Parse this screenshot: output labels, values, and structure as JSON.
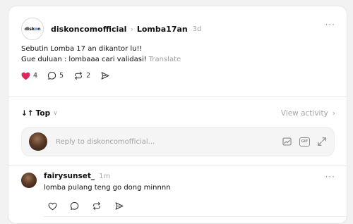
{
  "post": {
    "avatar_logo_text": "diskon",
    "author": "diskoncomofficial",
    "separator": "›",
    "topic": "Lomba17an",
    "time": "3d",
    "more": "···",
    "line1": "Sebutin Lomba 17 an dikantor lu!!",
    "line2": "Gue duluan : lombaaa cari validasi!",
    "translate": "Translate",
    "likes": "4",
    "replies": "5",
    "reposts": "2",
    "accent_like_color": "#e0245e"
  },
  "sort": {
    "arrows": "↓↑",
    "label": "Top",
    "dropdown": "∨",
    "view_activity": "View activity",
    "view_activity_arrow": "›"
  },
  "reply_box": {
    "placeholder": "Reply to diskoncomofficial...",
    "gif_label": "GIF"
  },
  "comment": {
    "author": "fairysunset_",
    "time": "1m",
    "more": "···",
    "text": "lomba pulang teng go dong minnnn"
  },
  "icons": [
    "heart-icon",
    "comment-icon",
    "repost-icon",
    "share-icon",
    "image-icon",
    "gif-icon",
    "expand-icon"
  ]
}
